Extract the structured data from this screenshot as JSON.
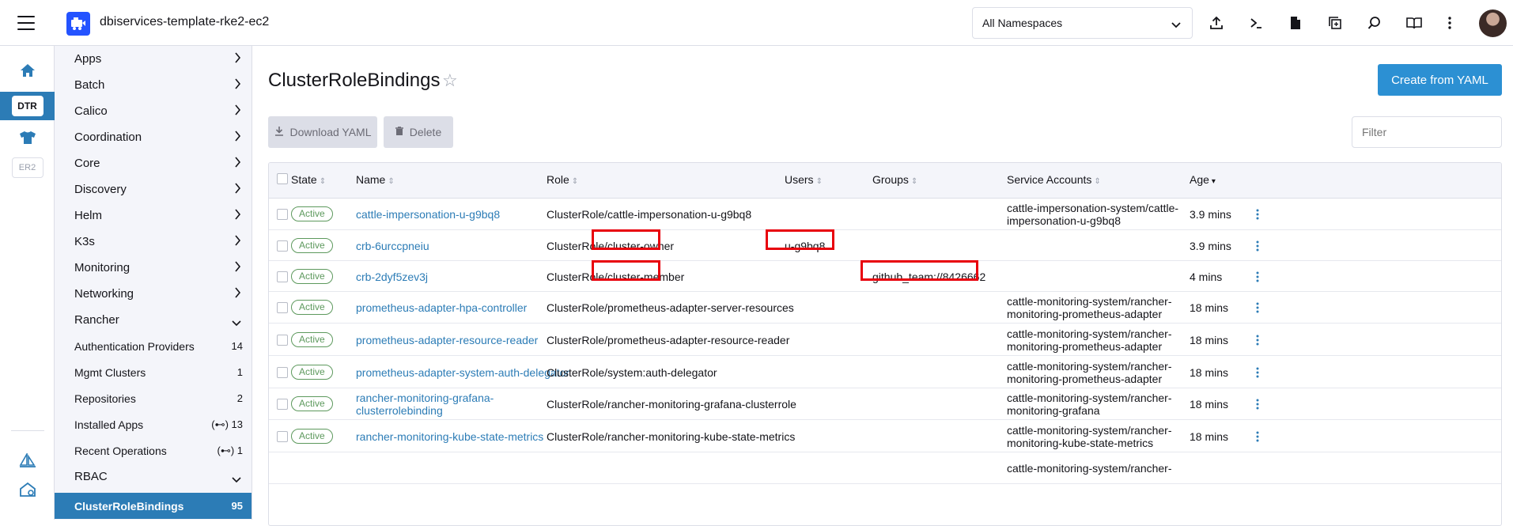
{
  "header": {
    "cluster_name": "dbiservices-template-rke2-ec2",
    "namespace_select": "All Namespaces",
    "icons": [
      "upload-icon",
      "shell-icon",
      "file-icon",
      "copy-icon",
      "search-icon",
      "book-icon",
      "more-icon"
    ]
  },
  "rail": {
    "home": "home-icon",
    "badge_active": "DTR",
    "badge_inactive": "ER2"
  },
  "sidebar": {
    "groups": [
      {
        "label": "Apps"
      },
      {
        "label": "Batch"
      },
      {
        "label": "Calico"
      },
      {
        "label": "Coordination"
      },
      {
        "label": "Core"
      },
      {
        "label": "Discovery"
      },
      {
        "label": "Helm"
      },
      {
        "label": "K3s"
      },
      {
        "label": "Monitoring"
      },
      {
        "label": "Networking"
      },
      {
        "label": "Rancher"
      }
    ],
    "rancher_items": [
      {
        "label": "Authentication Providers",
        "count": "14"
      },
      {
        "label": "Mgmt Clusters",
        "count": "1"
      },
      {
        "label": "Repositories",
        "count": "2"
      },
      {
        "label": "Installed Apps",
        "count": "(⊷) 13"
      },
      {
        "label": "Recent Operations",
        "count": "(⊷) 1"
      }
    ],
    "rbac": {
      "label": "RBAC"
    },
    "active_item": {
      "label": "ClusterRoleBindings",
      "count": "95"
    }
  },
  "main": {
    "title": "ClusterRoleBindings",
    "create_button": "Create from YAML",
    "download_button": "Download YAML",
    "delete_button": "Delete",
    "filter_placeholder": "Filter"
  },
  "table": {
    "columns": {
      "state": "State",
      "name": "Name",
      "role": "Role",
      "users": "Users",
      "groups": "Groups",
      "service_accounts": "Service Accounts",
      "age": "Age"
    },
    "rows": [
      {
        "state": "Active",
        "name": "cattle-impersonation-u-g9bq8",
        "name2": "",
        "role": "ClusterRole/cattle-impersonation-u-g9bq8",
        "users": "",
        "groups": "",
        "sa": "cattle-impersonation-system/cattle-",
        "sa2": "impersonation-u-g9bq8",
        "age": "3.9 mins"
      },
      {
        "state": "Active",
        "name": "crb-6urccpneiu",
        "name2": "",
        "role": "ClusterRole/cluster-owner",
        "users": "u-g9bq8",
        "groups": "",
        "sa": "",
        "sa2": "",
        "age": "3.9 mins"
      },
      {
        "state": "Active",
        "name": "crb-2dyf5zev3j",
        "name2": "",
        "role": "ClusterRole/cluster-member",
        "users": "",
        "groups": "github_team://8426662",
        "sa": "",
        "sa2": "",
        "age": "4 mins"
      },
      {
        "state": "Active",
        "name": "prometheus-adapter-hpa-controller",
        "name2": "",
        "role": "ClusterRole/prometheus-adapter-server-resources",
        "users": "",
        "groups": "",
        "sa": "cattle-monitoring-system/rancher-",
        "sa2": "monitoring-prometheus-adapter",
        "age": "18 mins"
      },
      {
        "state": "Active",
        "name": "prometheus-adapter-resource-reader",
        "name2": "",
        "role": "ClusterRole/prometheus-adapter-resource-reader",
        "users": "",
        "groups": "",
        "sa": "cattle-monitoring-system/rancher-",
        "sa2": "monitoring-prometheus-adapter",
        "age": "18 mins"
      },
      {
        "state": "Active",
        "name": "prometheus-adapter-system-auth-delegator",
        "name2": "",
        "role": "ClusterRole/system:auth-delegator",
        "users": "",
        "groups": "",
        "sa": "cattle-monitoring-system/rancher-",
        "sa2": "monitoring-prometheus-adapter",
        "age": "18 mins"
      },
      {
        "state": "Active",
        "name": "rancher-monitoring-grafana-",
        "name2": "clusterrolebinding",
        "role": "ClusterRole/rancher-monitoring-grafana-clusterrole",
        "users": "",
        "groups": "",
        "sa": "cattle-monitoring-system/rancher-",
        "sa2": "monitoring-grafana",
        "age": "18 mins"
      },
      {
        "state": "Active",
        "name": "rancher-monitoring-kube-state-metrics",
        "name2": "",
        "role": "ClusterRole/rancher-monitoring-kube-state-metrics",
        "users": "",
        "groups": "",
        "sa": "cattle-monitoring-system/rancher-",
        "sa2": "monitoring-kube-state-metrics",
        "age": "18 mins"
      },
      {
        "state": "",
        "name": "",
        "name2": "",
        "role": "",
        "users": "",
        "groups": "",
        "sa": "cattle-monitoring-system/rancher-",
        "sa2": "",
        "age": ""
      }
    ]
  },
  "colors": {
    "accent": "#2c7cb6",
    "primary_button": "#2c90d3",
    "active_green": "#5d995d",
    "highlight_red": "#e8000b"
  }
}
